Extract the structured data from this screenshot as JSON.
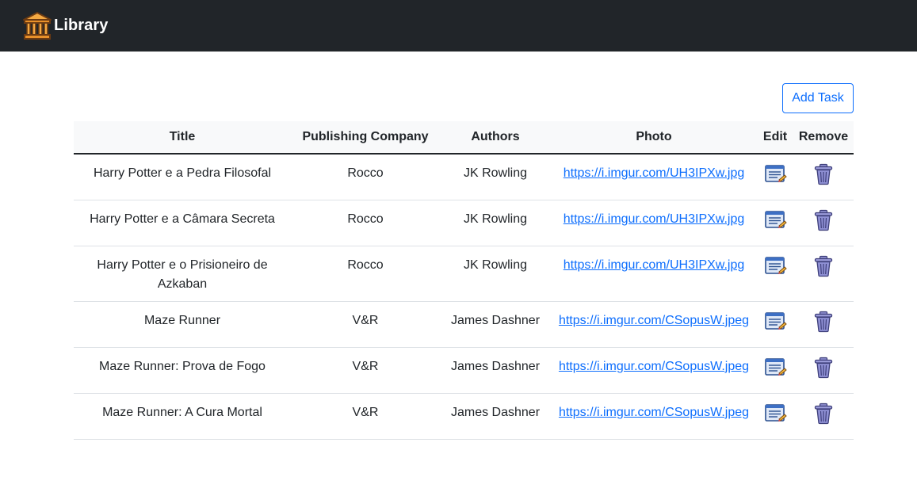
{
  "header": {
    "brand_text": "Library",
    "logo_icon": "library-building-icon"
  },
  "toolbar": {
    "add_label": "Add Task"
  },
  "table": {
    "columns": [
      "Title",
      "Publishing Company",
      "Authors",
      "Photo",
      "Edit",
      "Remove"
    ],
    "rows": [
      {
        "title": "Harry Potter e a Pedra Filosofal",
        "company": "Rocco",
        "authors": "JK Rowling",
        "photo": "https://i.imgur.com/UH3IPXw.jpg",
        "edit_icon": "edit-icon",
        "remove_icon": "trash-icon"
      },
      {
        "title": "Harry Potter e a Câmara Secreta",
        "company": "Rocco",
        "authors": "JK Rowling",
        "photo": "https://i.imgur.com/UH3IPXw.jpg",
        "edit_icon": "edit-icon",
        "remove_icon": "trash-icon"
      },
      {
        "title": "Harry Potter e o Prisioneiro de Azkaban",
        "company": "Rocco",
        "authors": "JK Rowling",
        "photo": "https://i.imgur.com/UH3IPXw.jpg",
        "edit_icon": "edit-icon",
        "remove_icon": "trash-icon"
      },
      {
        "title": "Maze Runner",
        "company": "V&R",
        "authors": "James Dashner",
        "photo": "https://i.imgur.com/CSopusW.jpeg",
        "edit_icon": "edit-icon",
        "remove_icon": "trash-icon"
      },
      {
        "title": "Maze Runner: Prova de Fogo",
        "company": "V&R",
        "authors": "James Dashner",
        "photo": "https://i.imgur.com/CSopusW.jpeg",
        "edit_icon": "edit-icon",
        "remove_icon": "trash-icon"
      },
      {
        "title": "Maze Runner: A Cura Mortal",
        "company": "V&R",
        "authors": "James Dashner",
        "photo": "https://i.imgur.com/CSopusW.jpeg",
        "edit_icon": "edit-icon",
        "remove_icon": "trash-icon"
      }
    ]
  },
  "colors": {
    "navbar_bg": "#212529",
    "accent": "#0d6efd",
    "row_border": "#dee2e6"
  }
}
